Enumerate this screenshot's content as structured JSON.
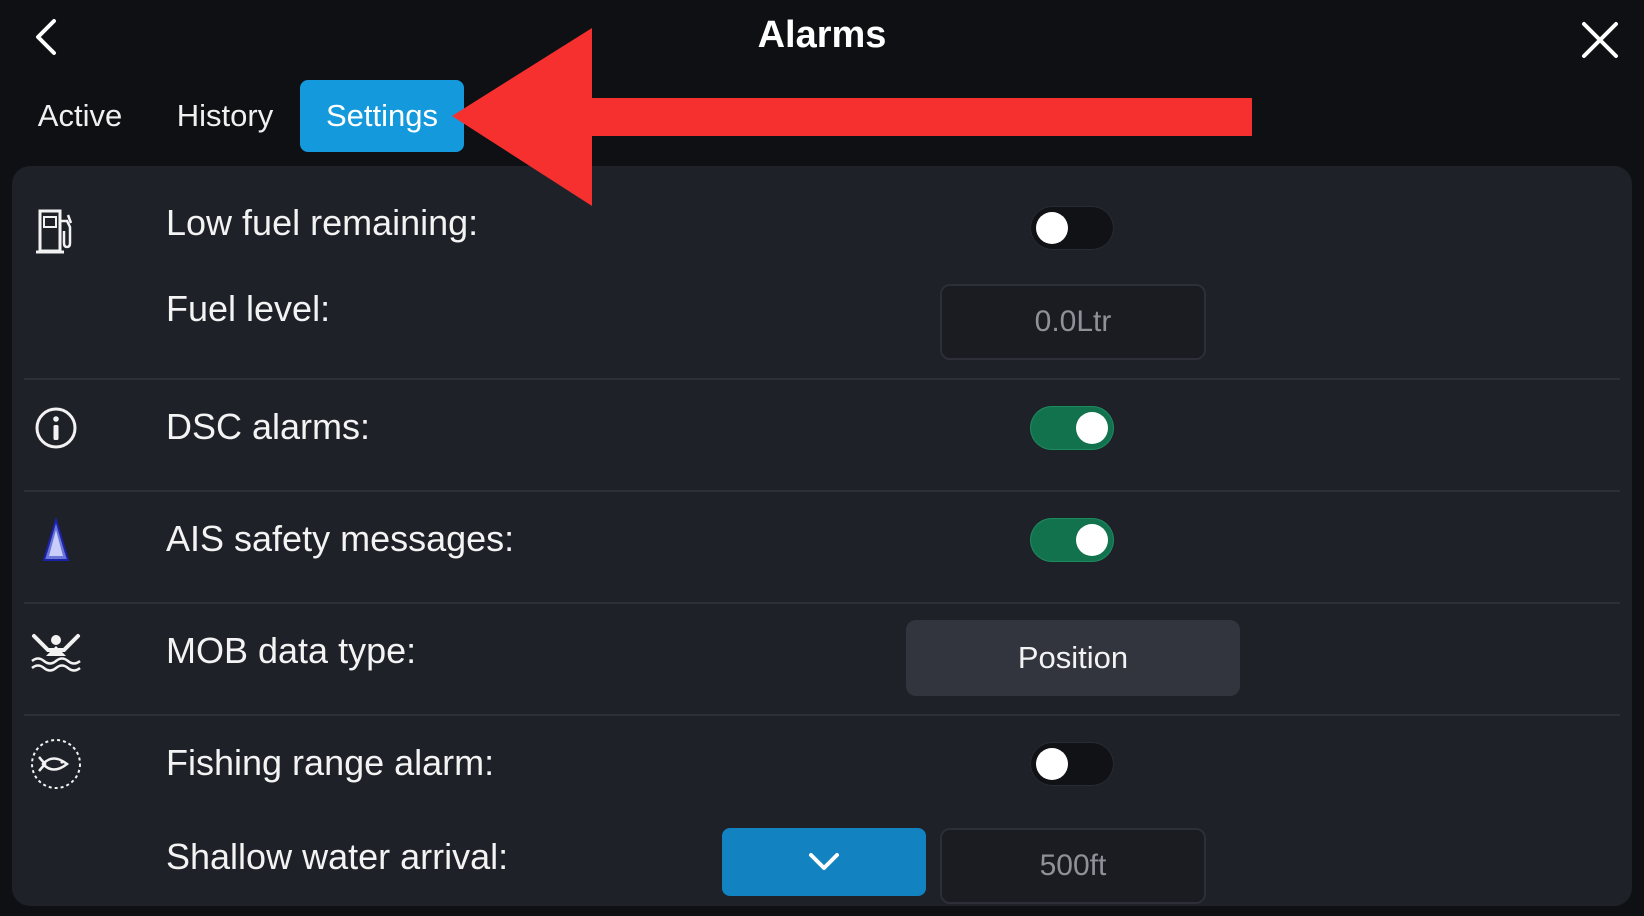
{
  "header": {
    "title": "Alarms",
    "back_icon": "chevron-left-icon",
    "close_icon": "close-icon"
  },
  "tabs": [
    {
      "label": "Active",
      "selected": false
    },
    {
      "label": "History",
      "selected": false
    },
    {
      "label": "Settings",
      "selected": true
    }
  ],
  "annotation": {
    "arrow_color": "#f5302f",
    "points_to": "Settings"
  },
  "settings": {
    "low_fuel": {
      "label": "Low fuel remaining:",
      "icon": "fuel-pump-icon",
      "enabled": false
    },
    "fuel_level": {
      "label": "Fuel level:",
      "value": "0.0Ltr"
    },
    "dsc": {
      "label": "DSC alarms:",
      "icon": "info-icon",
      "enabled": true
    },
    "ais": {
      "label": "AIS safety messages:",
      "icon": "ais-target-icon",
      "enabled": true
    },
    "mob": {
      "label": "MOB data type:",
      "icon": "man-overboard-icon",
      "value": "Position"
    },
    "fishing": {
      "label": "Fishing range alarm:",
      "icon": "fish-icon",
      "enabled": false
    },
    "shallow": {
      "label": "Shallow water arrival:",
      "value": "500ft",
      "dropdown_icon": "chevron-down-icon"
    }
  },
  "colors": {
    "accent": "#1499dc",
    "toggle_on": "#13724e",
    "background": "#0f1014",
    "panel": "#1f2128"
  }
}
